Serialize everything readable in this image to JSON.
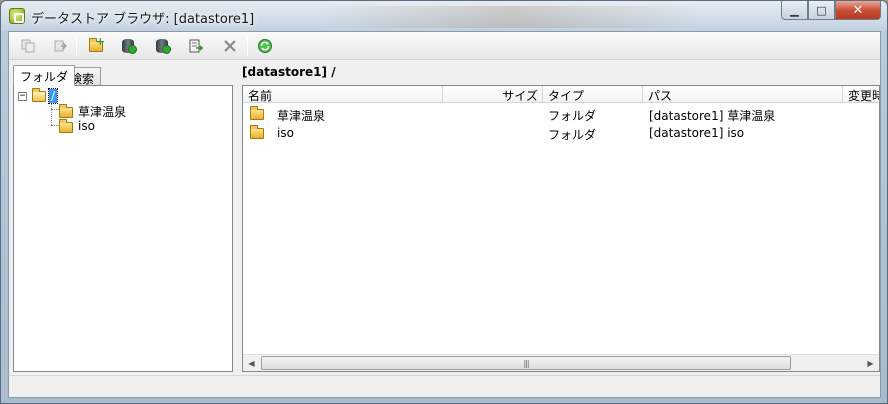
{
  "window": {
    "title": "データストア ブラウザ: [datastore1]",
    "minimize_glyph": "▁",
    "maximize_glyph": "□",
    "close_glyph": "✕"
  },
  "toolbar": {
    "buttons": [
      {
        "name": "copy-icon",
        "enabled": false
      },
      {
        "name": "move-icon",
        "enabled": false
      },
      {
        "name": "new-folder-icon",
        "enabled": true
      },
      {
        "name": "upload-to-datastore-icon",
        "enabled": true
      },
      {
        "name": "download-from-datastore-icon",
        "enabled": true
      },
      {
        "name": "add-to-inventory-icon",
        "enabled": true
      },
      {
        "name": "delete-icon",
        "enabled": false
      },
      {
        "name": "refresh-icon",
        "enabled": true
      }
    ]
  },
  "left_panel": {
    "tabs": [
      "フォルダ",
      "検索"
    ],
    "active_tab": "フォルダ",
    "tree": {
      "root": {
        "label": "/",
        "expander": "−",
        "selected": true
      },
      "children": [
        {
          "label": "草津温泉"
        },
        {
          "label": "iso"
        }
      ]
    }
  },
  "right_panel": {
    "path": "[datastore1] /",
    "columns": [
      "名前",
      "サイズ",
      "タイプ",
      "パス",
      "変更時"
    ],
    "rows": [
      {
        "name": "草津温泉",
        "size": "",
        "type": "フォルダ",
        "path": "[datastore1] 草津温泉",
        "modified": ""
      },
      {
        "name": "iso",
        "size": "",
        "type": "フォルダ",
        "path": "[datastore1] iso",
        "modified": ""
      }
    ],
    "scrollbar": {
      "left_arrow": "◀",
      "right_arrow": "▶",
      "grip": "|||"
    }
  },
  "colors": {
    "selection": "#3399ff",
    "folder_fill": "#f0c24c",
    "close_button": "#c74a32"
  }
}
